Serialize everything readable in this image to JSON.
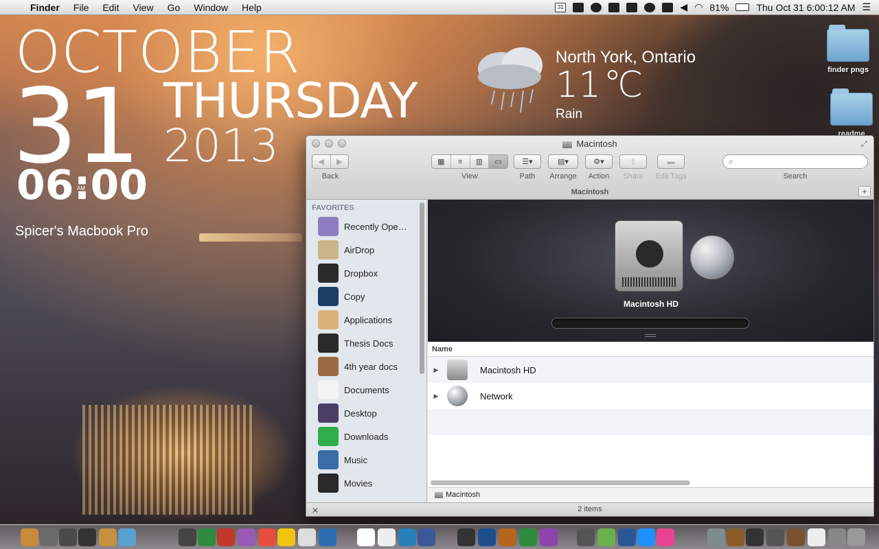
{
  "menubar": {
    "app_name": "Finder",
    "items": [
      "File",
      "Edit",
      "View",
      "Go",
      "Window",
      "Help"
    ],
    "calendar_day": "31",
    "battery": "81%",
    "datetime": "Thu Oct 31  6:00:12 AM"
  },
  "clock_widget": {
    "month": "OCTOBER",
    "day": "31",
    "weekday": "THURSDAY",
    "year": "2013",
    "time": "06:00",
    "ampm": "AM",
    "hostname": "Spicer's Macbook Pro"
  },
  "weather_widget": {
    "location": "North York, Ontario",
    "temp": "11",
    "unit": "C",
    "condition": "Rain"
  },
  "desktop_folders": [
    {
      "label": "finder pngs"
    },
    {
      "label": "readme"
    }
  ],
  "finder": {
    "title": "Macintosh",
    "toolbar": {
      "back_label": "Back",
      "view_label": "View",
      "path_label": "Path",
      "arrange_label": "Arrange",
      "action_label": "Action",
      "share_label": "Share",
      "edit_tags_label": "Edit Tags",
      "search_label": "Search",
      "search_placeholder": ""
    },
    "path_title": "Macintosh",
    "sidebar": {
      "header": "FAVORITES",
      "items": [
        {
          "label": "Recently Ope…",
          "icon": "recent-icon",
          "color": "#8e7cc3"
        },
        {
          "label": "AirDrop",
          "icon": "airdrop-icon",
          "color": "#c9b58a"
        },
        {
          "label": "Dropbox",
          "icon": "dropbox-icon",
          "color": "#2b2b2b"
        },
        {
          "label": "Copy",
          "icon": "copy-icon",
          "color": "#1e3d66"
        },
        {
          "label": "Applications",
          "icon": "applications-icon",
          "color": "#d9b27a"
        },
        {
          "label": "Thesis Docs",
          "icon": "briefcase-icon",
          "color": "#2a2a2a"
        },
        {
          "label": "4th year docs",
          "icon": "books-icon",
          "color": "#9a6b45"
        },
        {
          "label": "Documents",
          "icon": "document-icon",
          "color": "#f3f3f3"
        },
        {
          "label": "Desktop",
          "icon": "desktop-icon",
          "color": "#4a3e66"
        },
        {
          "label": "Downloads",
          "icon": "downloads-icon",
          "color": "#2fae4a"
        },
        {
          "label": "Music",
          "icon": "music-icon",
          "color": "#3a6da8"
        },
        {
          "label": "Movies",
          "icon": "movies-icon",
          "color": "#2a2a2a"
        }
      ]
    },
    "cover": {
      "selected_label": "Macintosh HD"
    },
    "list": {
      "column_name": "Name",
      "rows": [
        {
          "name": "Macintosh HD",
          "icon": "hard-drive-icon"
        },
        {
          "name": "Network",
          "icon": "network-globe-icon"
        }
      ]
    },
    "path_footer": "Macintosh",
    "status": "2 items"
  },
  "dock": {
    "colors": [
      "#c98a3a",
      "#6a6a6a",
      "#4a4a4a",
      "#333",
      "#c4923f",
      "#5aa0d0",
      "#444",
      "#2e8b3e",
      "#c0392b",
      "#9b59b6",
      "#e74c3c",
      "#f1c40f",
      "#ddd",
      "#2c6fb0",
      "#fff",
      "#eee",
      "#2980b9",
      "#3b5998",
      "#333",
      "#1f4e8c",
      "#b5651d",
      "#2e8b3e",
      "#8e44ad",
      "#555",
      "#6ab04c",
      "#2b5797",
      "#1e90ff",
      "#e84393",
      "#7f8c8d",
      "#8b5a2b",
      "#333",
      "#555",
      "#7a5230",
      "#eee",
      "#888",
      "#999"
    ]
  }
}
